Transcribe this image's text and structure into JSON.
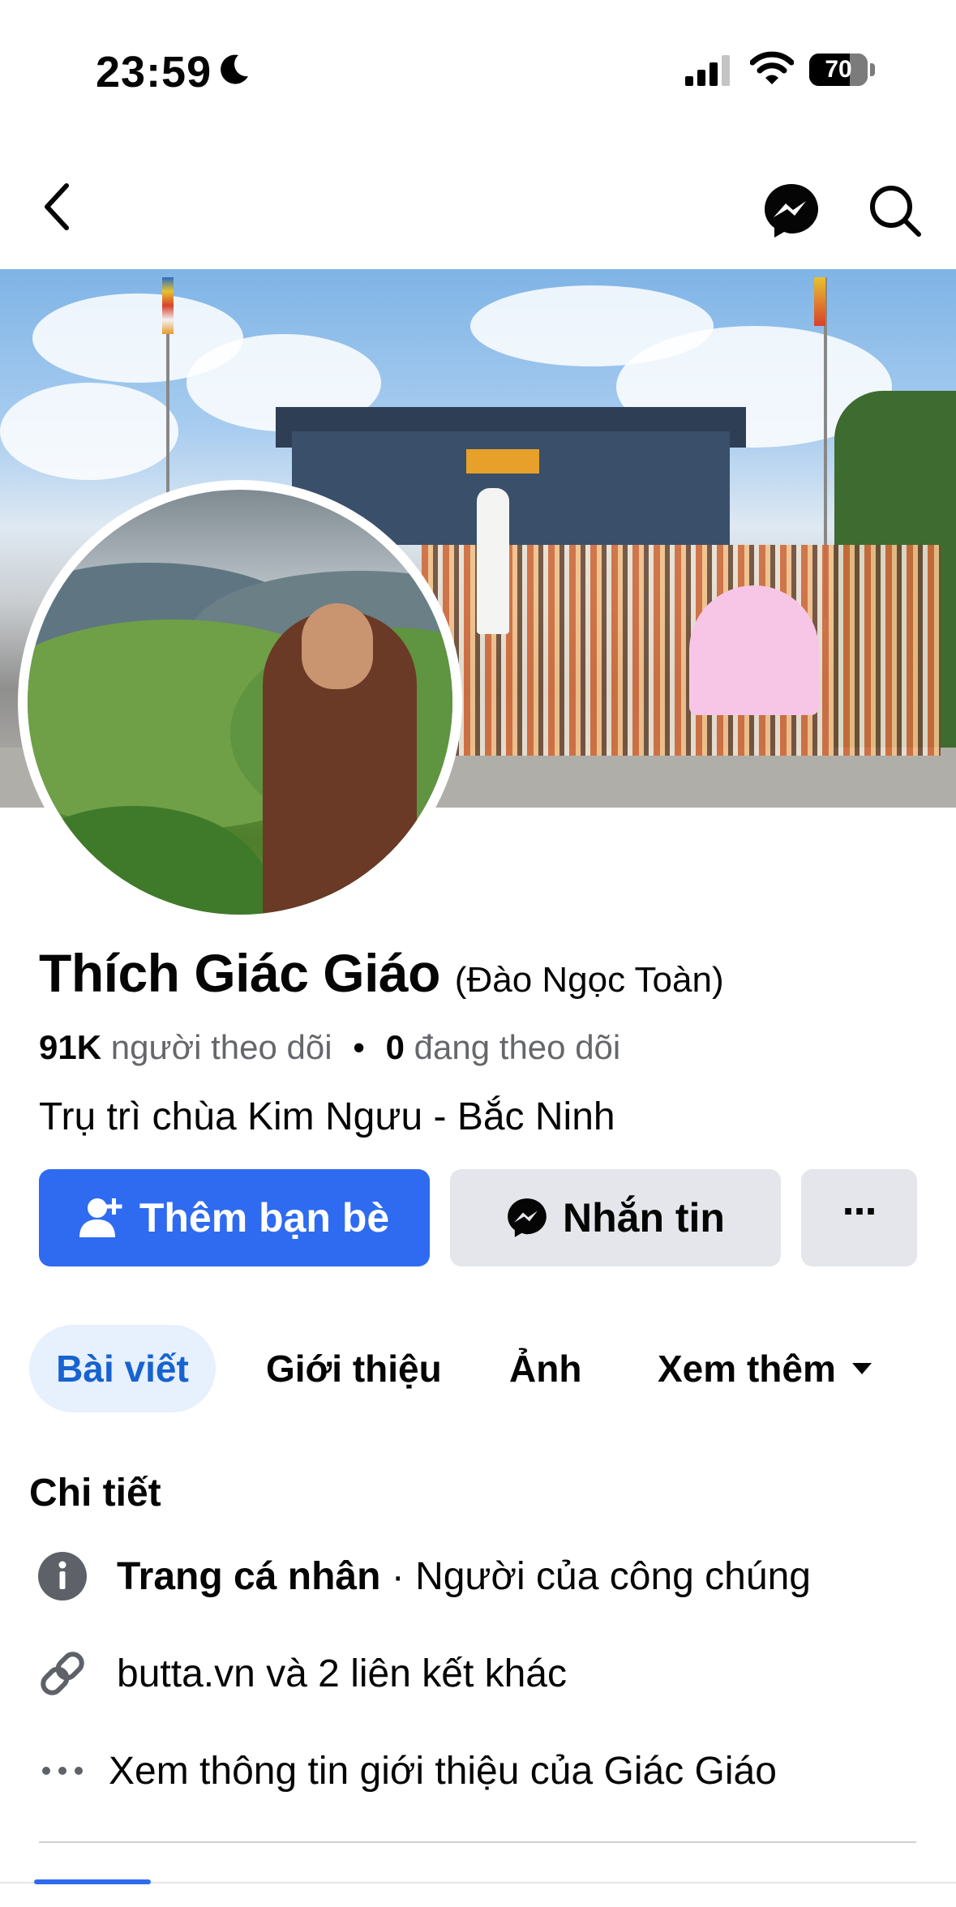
{
  "status_bar": {
    "time": "23:59",
    "battery": "70",
    "battery_level_percent": 70,
    "icons": [
      "moon-icon",
      "signal-icon",
      "wifi-icon",
      "battery-icon"
    ]
  },
  "nav": {
    "icons": [
      "back-icon",
      "messenger-icon",
      "search-icon"
    ]
  },
  "profile": {
    "name": "Thích Giác Giáo",
    "alternate_name": "(Đào Ngọc Toàn)",
    "followers_count": "91K",
    "followers_label": "người theo dõi",
    "separator": "•",
    "following_count": "0",
    "following_label": "đang theo dõi",
    "bio": "Trụ trì chùa Kim Ngưu - Bắc Ninh"
  },
  "actions": {
    "add_friend": "Thêm bạn bè",
    "message": "Nhắn tin",
    "more": "···"
  },
  "tabs": [
    {
      "label": "Bài viết",
      "active": true
    },
    {
      "label": "Giới thiệu",
      "active": false
    },
    {
      "label": "Ảnh",
      "active": false
    },
    {
      "label": "Xem thêm",
      "active": false
    }
  ],
  "details": {
    "title": "Chi tiết",
    "rows": [
      {
        "icon": "info-icon",
        "bold": "Trang cá nhân",
        "text": " · Người của công chúng"
      },
      {
        "icon": "link-icon",
        "text": "butta.vn và 2 liên kết khác"
      },
      {
        "icon": "ellipsis-icon",
        "text": "Xem thông tin giới thiệu của Giác Giáo"
      }
    ]
  },
  "colors": {
    "primary": "#2f6bf0",
    "tab_active_bg": "#e7f0fd",
    "tab_active_text": "#1763cf",
    "secondary_button": "#e4e6eb",
    "muted_text": "#65676b"
  }
}
